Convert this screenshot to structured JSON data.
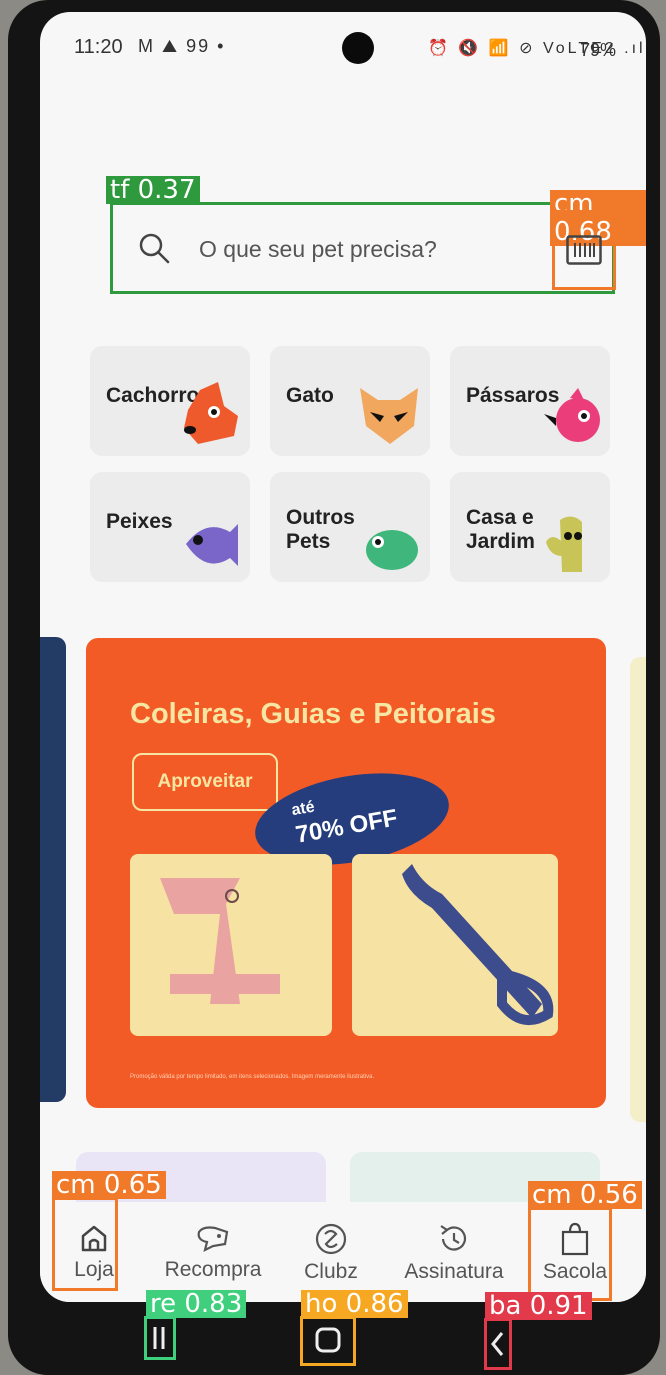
{
  "status_bar": {
    "time": "11:20",
    "left_icons": "M ⛰ 99 •",
    "right_icons": "⏰ 🔇 📶 ⊘ VoLTE2 .ıl",
    "battery": "79%"
  },
  "search": {
    "placeholder": "O que seu pet precisa?",
    "label": "tf 0.37"
  },
  "barcode": {
    "label": "cm 0.68"
  },
  "categories": [
    {
      "label": "Cachorro"
    },
    {
      "label": "Gato"
    },
    {
      "label": "Pássaros"
    },
    {
      "label": "Peixes"
    },
    {
      "label_line1": "Outros",
      "label_line2": "Pets"
    },
    {
      "label_line1": "Casa e",
      "label_line2": "Jardim"
    }
  ],
  "promo": {
    "title": "Coleiras, Guias e Peitorais",
    "cta": "Aproveitar",
    "badge_small": "até",
    "badge_big": "70% OFF",
    "fineprint": "Promoção válida por tempo limitado, em itens selecionados. Imagem meramente ilustrativa."
  },
  "bottom_nav": [
    {
      "label": "Loja",
      "detector": "cm 0.65"
    },
    {
      "label": "Recompra"
    },
    {
      "label": "Clubz"
    },
    {
      "label": "Assinatura"
    },
    {
      "label": "Sacola",
      "detector": "cm 0.56"
    }
  ],
  "system_nav": {
    "recents": "re 0.83",
    "home": "ho 0.86",
    "back": "ba 0.91"
  },
  "colors": {
    "box_green": "#2f9a3d",
    "box_orange": "#f07a2a",
    "promo": "#f35b26"
  }
}
